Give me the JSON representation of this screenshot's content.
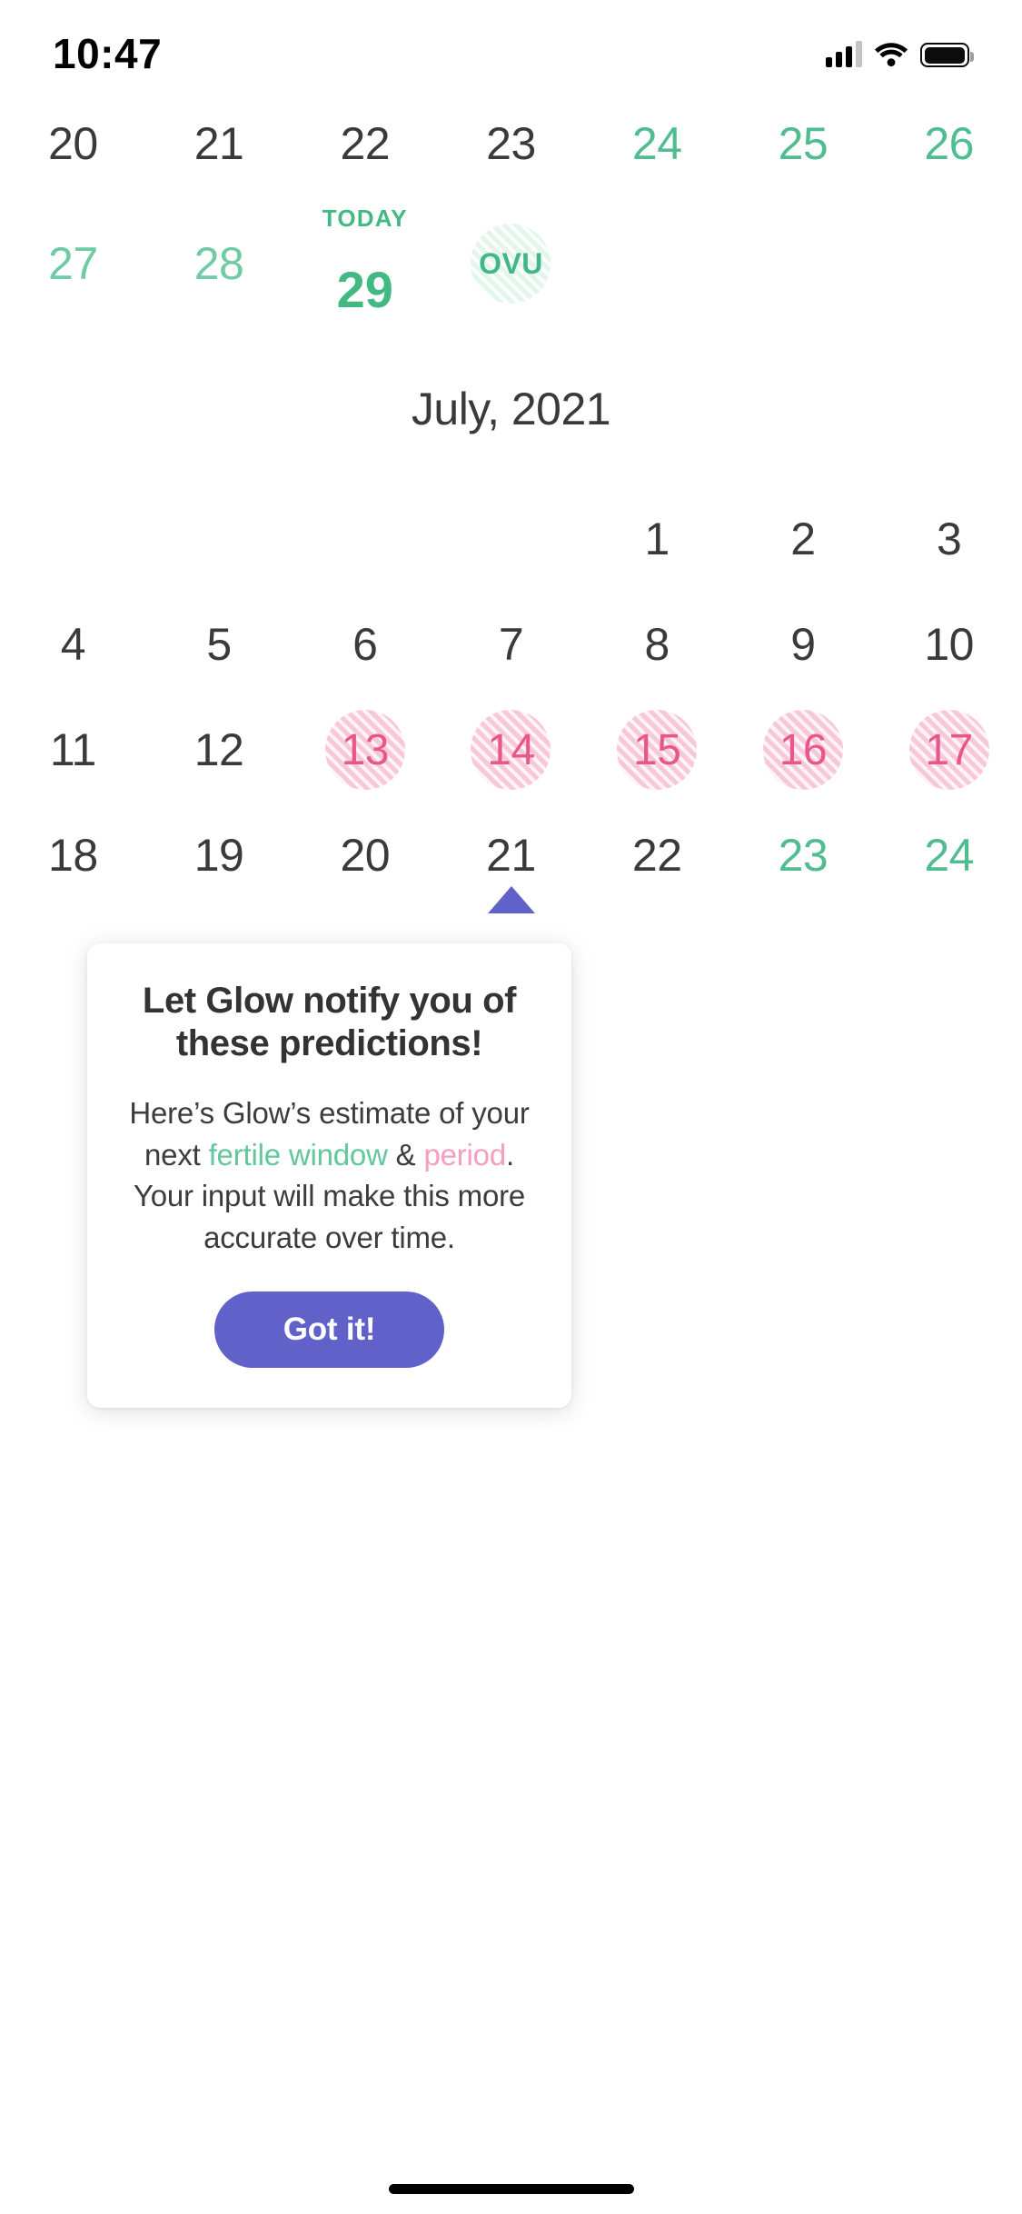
{
  "status_bar": {
    "time": "10:47",
    "signal_icon": "cellular-signal-icon",
    "wifi_icon": "wifi-icon",
    "battery_icon": "battery-icon"
  },
  "colors": {
    "green": "#4fbd8f",
    "green_muted": "#6ecba4",
    "today_green": "#42b983",
    "pink_fill": "#f9c8d8",
    "pink_text": "#e8568c",
    "pink_light": "#f79dbd",
    "ovu_fill": "#e3f5ec",
    "accent_purple": "#6161ca",
    "text_dark": "#3a3a3c"
  },
  "calendar": {
    "previous_weeks": [
      {
        "days": [
          {
            "label": "20",
            "style": "dark"
          },
          {
            "label": "21",
            "style": "dark"
          },
          {
            "label": "22",
            "style": "dark"
          },
          {
            "label": "23",
            "style": "dark"
          },
          {
            "label": "24",
            "style": "green"
          },
          {
            "label": "25",
            "style": "green"
          },
          {
            "label": "26",
            "style": "green"
          }
        ]
      },
      {
        "days": [
          {
            "label": "27",
            "style": "muted-green"
          },
          {
            "label": "28",
            "style": "muted-green"
          },
          {
            "label": "29",
            "style": "today",
            "today_label": "TODAY"
          },
          {
            "label": "OVU",
            "style": "ovu-badge"
          },
          {
            "label": "",
            "style": "empty"
          },
          {
            "label": "",
            "style": "empty"
          },
          {
            "label": "",
            "style": "empty"
          }
        ]
      }
    ],
    "month_title": "July, 2021",
    "month_weeks": [
      {
        "days": [
          {
            "label": "",
            "style": "empty"
          },
          {
            "label": "",
            "style": "empty"
          },
          {
            "label": "",
            "style": "empty"
          },
          {
            "label": "",
            "style": "empty"
          },
          {
            "label": "1",
            "style": "dark"
          },
          {
            "label": "2",
            "style": "dark"
          },
          {
            "label": "3",
            "style": "dark"
          }
        ]
      },
      {
        "days": [
          {
            "label": "4",
            "style": "dark"
          },
          {
            "label": "5",
            "style": "dark"
          },
          {
            "label": "6",
            "style": "dark"
          },
          {
            "label": "7",
            "style": "dark"
          },
          {
            "label": "8",
            "style": "dark"
          },
          {
            "label": "9",
            "style": "dark"
          },
          {
            "label": "10",
            "style": "dark"
          }
        ]
      },
      {
        "days": [
          {
            "label": "11",
            "style": "dark"
          },
          {
            "label": "12",
            "style": "dark"
          },
          {
            "label": "13",
            "style": "period-badge"
          },
          {
            "label": "14",
            "style": "period-badge"
          },
          {
            "label": "15",
            "style": "period-badge"
          },
          {
            "label": "16",
            "style": "period-badge"
          },
          {
            "label": "17",
            "style": "period-badge"
          }
        ]
      },
      {
        "days": [
          {
            "label": "18",
            "style": "dark"
          },
          {
            "label": "19",
            "style": "dark"
          },
          {
            "label": "20",
            "style": "dark"
          },
          {
            "label": "21",
            "style": "dark"
          },
          {
            "label": "22",
            "style": "dark"
          },
          {
            "label": "23",
            "style": "green"
          },
          {
            "label": "24",
            "style": "green"
          }
        ]
      }
    ]
  },
  "popup": {
    "title": "Let Glow notify you of these predictions!",
    "body_part_1": "Here’s Glow’s estimate of your next ",
    "body_fertile": "fertile window",
    "body_amp": " & ",
    "body_period": "period",
    "body_part_2": ". Your input will make this more accurate over time.",
    "cta_label": "Got it!"
  }
}
